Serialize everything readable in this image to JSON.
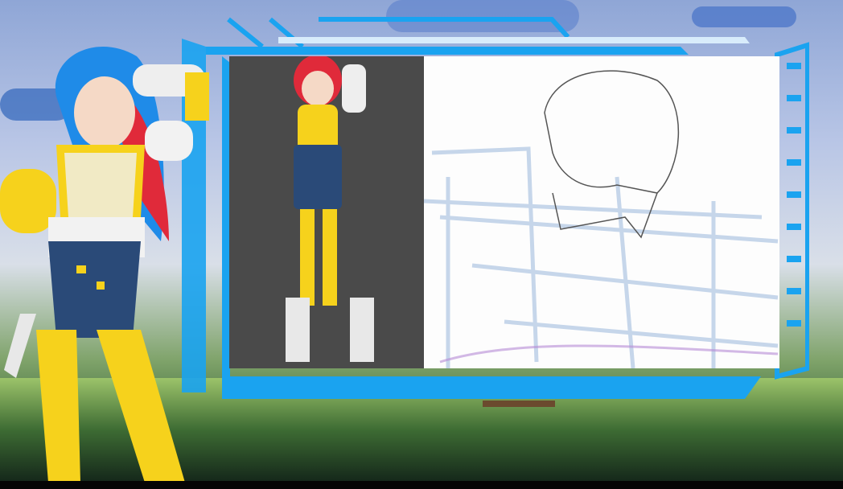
{
  "colors": {
    "frame_accent": "#1aa3f0",
    "frame_light": "#d8ecfb",
    "reference_panel_bg": "#4a4a4a",
    "sketch_panel_bg": "#fdfdfd",
    "hair_blue": "#1f8be8",
    "hair_red": "#e02a3a",
    "outfit_yellow": "#f6d21c",
    "skirt_navy": "#2a4a78",
    "sketch_line": "#b9cde6"
  }
}
